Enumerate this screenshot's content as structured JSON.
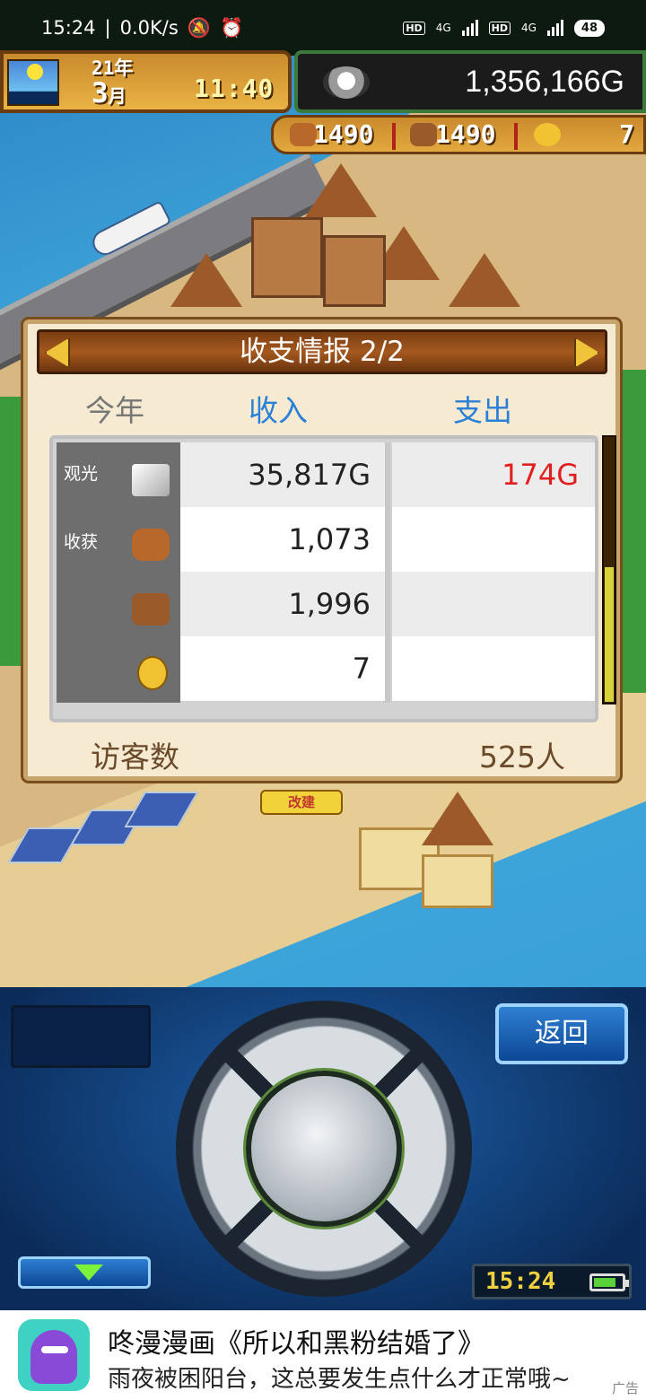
{
  "status_bar": {
    "time": "15:24",
    "speed": "0.0K/s",
    "network1": "4G",
    "network2": "4G",
    "hd1": "HD",
    "hd2": "HD",
    "battery": "48"
  },
  "hud": {
    "year": "21年",
    "month": "3",
    "month_unit": "月",
    "time": "11:40",
    "money": "1,356,166G",
    "resources": [
      {
        "icon": "meat-icon",
        "value": "1490"
      },
      {
        "icon": "wood-icon",
        "value": "1490"
      },
      {
        "icon": "gold-medal-icon",
        "value": "7"
      }
    ]
  },
  "scene": {
    "sign_label": "改建"
  },
  "dialog": {
    "title": "收支情报 2/2",
    "columns": {
      "period": "今年",
      "income": "收入",
      "expense": "支出"
    },
    "rows": [
      {
        "label": "观光",
        "icon": "silver-bar-icon",
        "income": "35,817G",
        "expense": "174G"
      },
      {
        "label": "收获",
        "icon": "meat-icon",
        "income": "1,073",
        "expense": ""
      },
      {
        "label": "",
        "icon": "wood-icon",
        "income": "1,996",
        "expense": ""
      },
      {
        "label": "",
        "icon": "gold-medal-icon",
        "income": "7",
        "expense": ""
      }
    ],
    "visitors_label": "访客数",
    "visitors_value": "525人",
    "expense_color": "#e02020",
    "header_color": "#2a7fd6"
  },
  "controller": {
    "back_label": "返回",
    "clock": "15:24"
  },
  "ad": {
    "title": "咚漫漫画《所以和黑粉结婚了》",
    "subtitle": "雨夜被困阳台，这总要发生点什么才正常哦~",
    "tag": "广告"
  }
}
